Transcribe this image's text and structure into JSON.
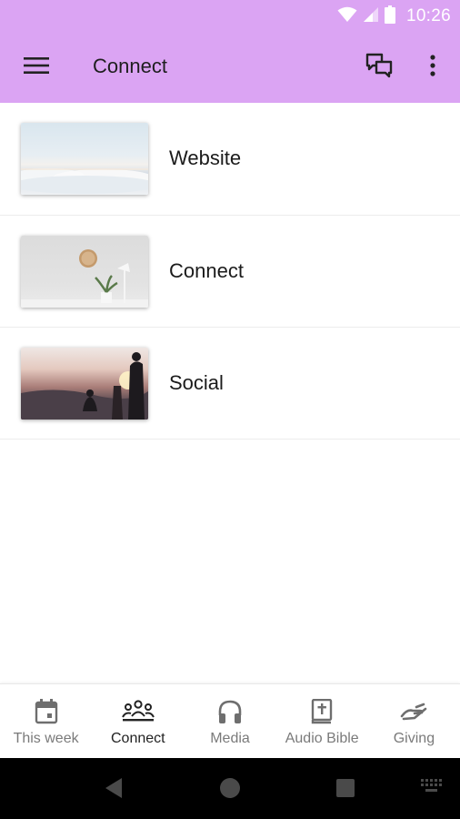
{
  "status_bar": {
    "time": "10:26",
    "icons": [
      "wifi-icon",
      "signal-icon",
      "battery-icon"
    ]
  },
  "app_bar": {
    "title": "Connect",
    "background_color": "#dba4f3",
    "icons": [
      "menu-icon",
      "chat-icon",
      "more-vert-icon"
    ]
  },
  "list": {
    "items": [
      {
        "label": "Website",
        "thumbnail": "clouds-sky-image"
      },
      {
        "label": "Connect",
        "thumbnail": "wall-clock-plant-image"
      },
      {
        "label": "Social",
        "thumbnail": "sunset-silhouettes-image"
      }
    ]
  },
  "bottom_nav": {
    "items": [
      {
        "label": "This week",
        "icon": "calendar-icon",
        "active": false
      },
      {
        "label": "Connect",
        "icon": "people-group-icon",
        "active": true
      },
      {
        "label": "Media",
        "icon": "headphones-icon",
        "active": false
      },
      {
        "label": "Audio Bible",
        "icon": "bible-icon",
        "active": false
      },
      {
        "label": "Giving",
        "icon": "giving-hand-icon",
        "active": false
      }
    ]
  },
  "system_nav": {
    "icons": [
      "back-icon",
      "home-icon",
      "recents-icon",
      "keyboard-icon"
    ]
  }
}
